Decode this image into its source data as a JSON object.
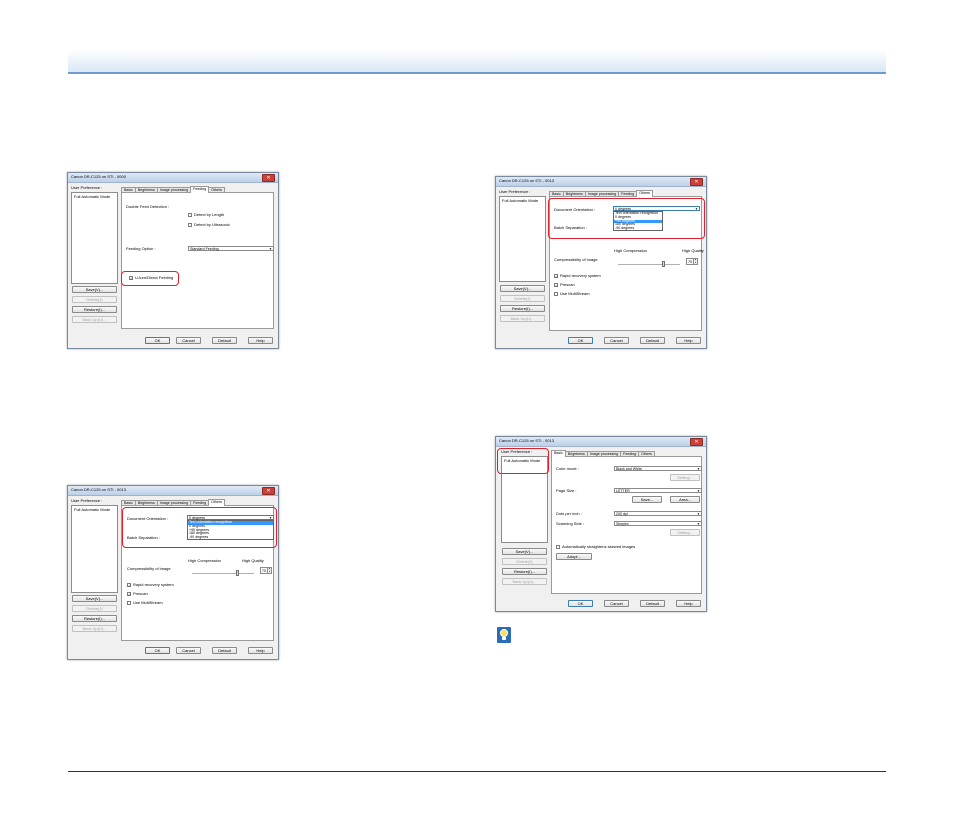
{
  "shared": {
    "preference_label": "User Preference :",
    "preference_item": "Full Automatic Mode",
    "save_btn": "Save(V)...",
    "delete_btn": "Delete(J)",
    "restore_btn": "Restore(I)...",
    "backup_btn": "Back Up(U)...",
    "ok_btn": "OK",
    "cancel_btn": "Cancel",
    "default_btn": "Default",
    "help_btn": "Help",
    "tab_basic": "Basic",
    "tab_brightness": "Brightness",
    "tab_image": "Image processing",
    "tab_feeding": "Feeding",
    "tab_others": "Others",
    "close_glyph": "✕"
  },
  "dialog1": {
    "title": "Canon DR-C125 on STI - 0000",
    "double_feed_label": "Double Feed Detection :",
    "detect_length": "Detect by Length",
    "detect_ultrasonic": "Detect by Ultrasonic",
    "feeding_option_label": "Feeding Option :",
    "feeding_option_value": "Standard Feeding",
    "uturn_label": "U-turn/Direct Feeding",
    "uturn_checked": true
  },
  "others_dialog": {
    "title": "Canon DR-C125 on STI - 0013",
    "doc_orientation_label": "Document Orientation :",
    "doc_orientation_value": "0 degrees",
    "orientation_options": [
      "Text orientation recognition",
      "0 degrees",
      "+90 degrees",
      "180 degrees",
      "-90 degrees"
    ],
    "batch_sep_label": "Batch Separation :",
    "high_compression": "High Compression",
    "high_quality": "High Quality",
    "compress_label": "Compressibility of image",
    "compress_value": "75",
    "rapid_recovery": "Rapid recovery system",
    "prescan": "Prescan",
    "multistream": "Use MultiStream"
  },
  "dialog4": {
    "title": "Canon DR-C125 on STI - 0013",
    "color_mode_label": "Color mode :",
    "color_mode_value": "Black and White",
    "setting_btn": "Setting...",
    "page_size_label": "Page Size :",
    "page_size_value": "LETTER",
    "save_size_btn": "Save...",
    "area_btn": "Area...",
    "dpi_label": "Dots per inch :",
    "dpi_value": "200 dpi",
    "scan_side_label": "Scanning Side :",
    "scan_side_value": "Simplex",
    "setting2_btn": "Setting...",
    "straighten_label": "Automatically straightens skewed images",
    "adopt_btn": "Adopt..."
  },
  "accent_red": "#e0202a",
  "header_blue": "#6f9bcb"
}
